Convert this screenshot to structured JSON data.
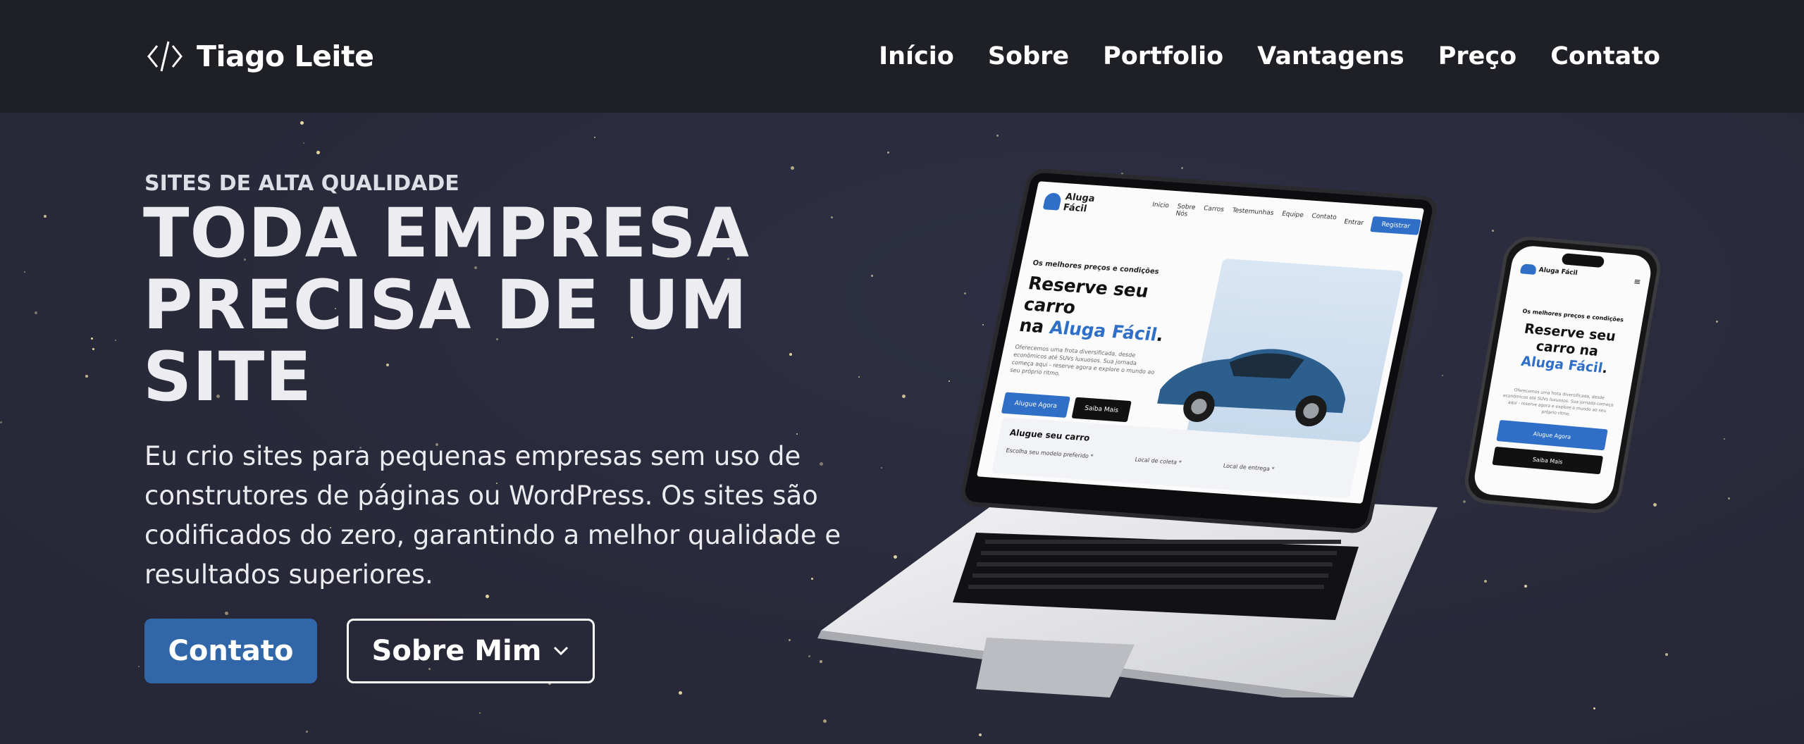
{
  "header": {
    "brand": {
      "icon": "code-brackets-icon",
      "name": "Tiago Leite"
    },
    "nav": [
      {
        "label": "Início"
      },
      {
        "label": "Sobre"
      },
      {
        "label": "Portfolio"
      },
      {
        "label": "Vantagens"
      },
      {
        "label": "Preço"
      },
      {
        "label": "Contato"
      }
    ]
  },
  "hero": {
    "eyebrow": "SITES DE ALTA QUALIDADE",
    "headline": "TODA EMPRESA PRECISA DE UM SITE",
    "lead": "Eu crio sites para pequenas empresas sem uso de construtores de páginas ou WordPress. Os sites são codificados do zero, garantindo a melhor qualidade e resultados superiores.",
    "primary_button": "Contato",
    "secondary_button": "Sobre Mim",
    "secondary_icon": "chevron-down-icon"
  },
  "mockup": {
    "brand": "Aluga Fácil",
    "nav": [
      "Início",
      "Sobre Nós",
      "Carros",
      "Testemunhas",
      "Equipe",
      "Contato"
    ],
    "login": "Entrar",
    "register": "Registrar",
    "kicker": "Os melhores preços e condições",
    "title_line1": "Reserve seu carro",
    "title_na": "na",
    "title_brand": "Aluga Fácil",
    "description": "Oferecemos uma frota diversificada, desde econômicos até SUVs luxuosos. Sua jornada começa aqui - reserve agora e explore o mundo ao seu próprio ritmo.",
    "btn_rent": "Alugue Agora",
    "btn_more": "Saiba Mais",
    "form_title": "Alugue seu carro",
    "form_fields": [
      "Escolha seu modelo preferido *",
      "Local de coleta *",
      "Local de entrega *"
    ],
    "phone_title_line1": "Reserve seu",
    "phone_title_line2": "carro na",
    "accent_color": "#2f6fc7"
  },
  "colors": {
    "background": "#292a3c",
    "header": "#1f1f26",
    "primary": "#3167a8"
  }
}
